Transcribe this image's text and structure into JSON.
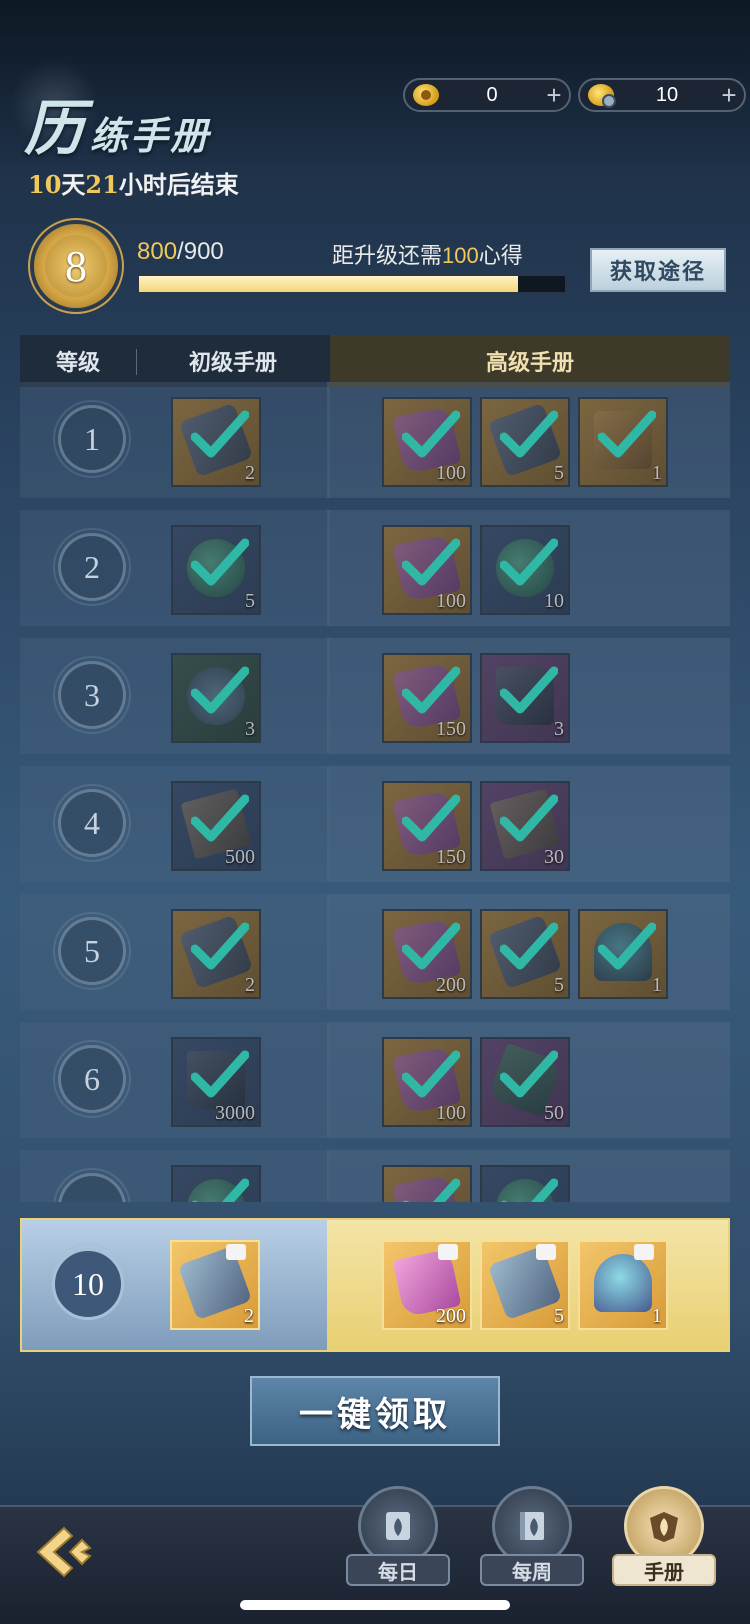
{
  "header": {
    "title_first": "历",
    "title_rest": "练手册",
    "countdown_days": "10",
    "countdown_days_unit": "天",
    "countdown_hours": "21",
    "countdown_suffix": "小时后结束"
  },
  "currencies": [
    {
      "icon": "gold-ingot-icon",
      "value": "0",
      "plus": "+"
    },
    {
      "icon": "silver-ingot-icon",
      "value": "10",
      "plus": "+"
    }
  ],
  "level": {
    "current": "8",
    "progress_current": "800",
    "progress_total": "/900",
    "progress_fraction": 0.8889,
    "need_prefix": "距升级还需",
    "need_amount": "100",
    "need_suffix": "心得",
    "get_button": "获取途径"
  },
  "table_header": {
    "level": "等级",
    "basic": "初级手册",
    "advanced": "高级手册"
  },
  "rows": [
    {
      "level": "1",
      "basic": [
        {
          "kind": "gold",
          "art": "scroll",
          "qty": "2"
        }
      ],
      "advanced": [
        {
          "kind": "gold",
          "art": "shard",
          "qty": "100"
        },
        {
          "kind": "gold",
          "art": "scroll",
          "qty": "5"
        },
        {
          "kind": "gold",
          "art": "chest",
          "qty": "1"
        }
      ]
    },
    {
      "level": "2",
      "basic": [
        {
          "kind": "blue",
          "art": "fruit",
          "qty": "5"
        }
      ],
      "advanced": [
        {
          "kind": "gold",
          "art": "shard",
          "qty": "100"
        },
        {
          "kind": "blue",
          "art": "fruit",
          "qty": "10"
        }
      ]
    },
    {
      "level": "3",
      "basic": [
        {
          "kind": "green",
          "art": "horn",
          "qty": "3"
        }
      ],
      "advanced": [
        {
          "kind": "gold",
          "art": "shard",
          "qty": "150"
        },
        {
          "kind": "purple",
          "art": "rock",
          "qty": "3"
        }
      ]
    },
    {
      "level": "4",
      "basic": [
        {
          "kind": "blue",
          "art": "wood",
          "qty": "500"
        }
      ],
      "advanced": [
        {
          "kind": "gold",
          "art": "shard",
          "qty": "150"
        },
        {
          "kind": "purple",
          "art": "wood",
          "qty": "30"
        }
      ]
    },
    {
      "level": "5",
      "basic": [
        {
          "kind": "gold",
          "art": "scroll",
          "qty": "2"
        }
      ],
      "advanced": [
        {
          "kind": "gold",
          "art": "shard",
          "qty": "200"
        },
        {
          "kind": "gold",
          "art": "scroll",
          "qty": "5"
        },
        {
          "kind": "gold",
          "art": "orb",
          "qty": "1"
        }
      ]
    },
    {
      "level": "6",
      "basic": [
        {
          "kind": "blue",
          "art": "rock",
          "qty": "3000"
        }
      ],
      "advanced": [
        {
          "kind": "gold",
          "art": "shard",
          "qty": "100"
        },
        {
          "kind": "purple",
          "art": "crystal",
          "qty": "50"
        }
      ]
    },
    {
      "level": "",
      "basic": [
        {
          "kind": "blue",
          "art": "fruit",
          "qty": ""
        }
      ],
      "advanced": [
        {
          "kind": "gold",
          "art": "shard",
          "qty": ""
        },
        {
          "kind": "blue",
          "art": "fruit",
          "qty": ""
        }
      ]
    }
  ],
  "highlight_row": {
    "level": "10",
    "basic": [
      {
        "art": "scroll",
        "qty": "2"
      }
    ],
    "advanced": [
      {
        "art": "shard",
        "qty": "200"
      },
      {
        "art": "scroll",
        "qty": "5"
      },
      {
        "art": "orb",
        "qty": "1"
      }
    ]
  },
  "claim_button": "一键领取",
  "nav": {
    "tabs": [
      {
        "label": "每日",
        "icon": "daily-scroll-icon",
        "active": false
      },
      {
        "label": "每周",
        "icon": "weekly-book-icon",
        "active": false
      },
      {
        "label": "手册",
        "icon": "manual-flame-icon",
        "active": true
      }
    ],
    "back_icon": "back-arrow-icon"
  },
  "colors": {
    "accent_gold": "#f0c95a",
    "check": "#2fb8a6",
    "highlight_border": "#e8d27a"
  }
}
